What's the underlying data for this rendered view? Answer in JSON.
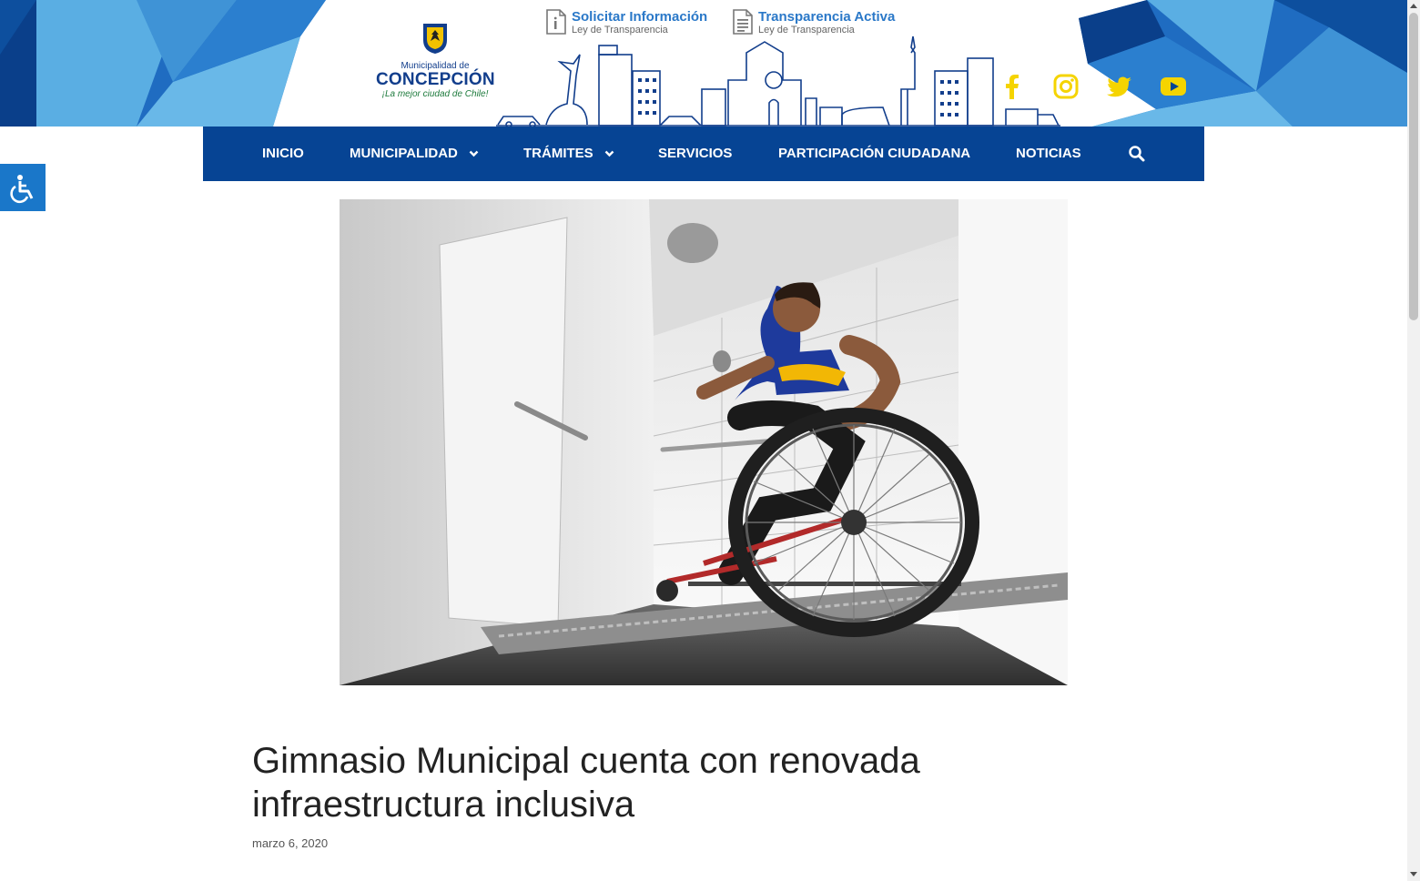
{
  "colors": {
    "nav_bg": "#064494",
    "accent_blue": "#1a77c9",
    "social_yellow": "#f5d400",
    "title_text": "#222222"
  },
  "header": {
    "logo": {
      "subtitle": "Municipalidad de",
      "name": "CONCEPCIÓN",
      "slogan": "¡La mejor ciudad de Chile!"
    },
    "links": [
      {
        "title": "Solicitar Información",
        "subtitle": "Ley de Transparencia",
        "icon": "document-info-icon"
      },
      {
        "title": "Transparencia Activa",
        "subtitle": "Ley de Transparencia",
        "icon": "document-list-icon"
      }
    ],
    "social": [
      "facebook-icon",
      "instagram-icon",
      "twitter-icon",
      "youtube-icon"
    ]
  },
  "nav": {
    "items": [
      {
        "label": "INICIO",
        "dropdown": false
      },
      {
        "label": "MUNICIPALIDAD",
        "dropdown": true
      },
      {
        "label": "TRÁMITES",
        "dropdown": true
      },
      {
        "label": "SERVICIOS",
        "dropdown": false
      },
      {
        "label": "PARTICIPACIÓN CIUDADANA",
        "dropdown": false
      },
      {
        "label": "NOTICIAS",
        "dropdown": false
      }
    ],
    "search_icon": "search-icon"
  },
  "accessibility_button": {
    "icon": "wheelchair-accessibility-icon"
  },
  "article": {
    "title": "Gimnasio Municipal cuenta con renovada infraestructura inclusiva",
    "date": "marzo 6, 2020"
  }
}
